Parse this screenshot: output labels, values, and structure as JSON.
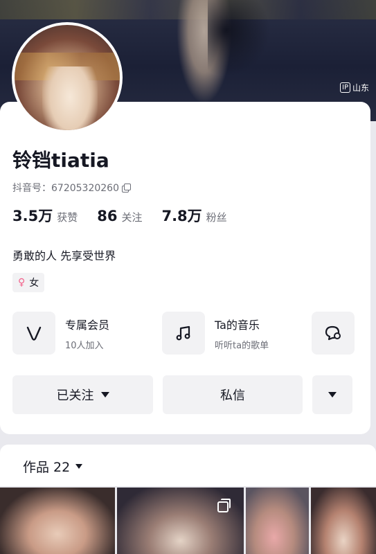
{
  "header": {
    "ip_badge": "IP",
    "ip_location": "山东"
  },
  "profile": {
    "name": "铃铛tiatia",
    "douyin_id": "抖音号：67205320260",
    "stats": [
      {
        "value": "3.5万",
        "label": "获赞"
      },
      {
        "value": "86",
        "label": "关注"
      },
      {
        "value": "7.8万",
        "label": "粉丝"
      }
    ],
    "bio": "勇敢的人 先享受世界",
    "gender": "女"
  },
  "features": [
    {
      "title": "专属会员",
      "subtitle": "10人加入",
      "icon": "v-icon"
    },
    {
      "title": "Ta的音乐",
      "subtitle": "听听ta的歌单",
      "icon": "music-icon"
    }
  ],
  "actions": {
    "follow": "已关注",
    "message": "私信"
  },
  "works": {
    "label": "作品 22"
  },
  "colors": {
    "accent": "#161823",
    "muted": "#6b6d76",
    "surface": "#f2f2f4",
    "gender_icon": "#f2618a"
  }
}
